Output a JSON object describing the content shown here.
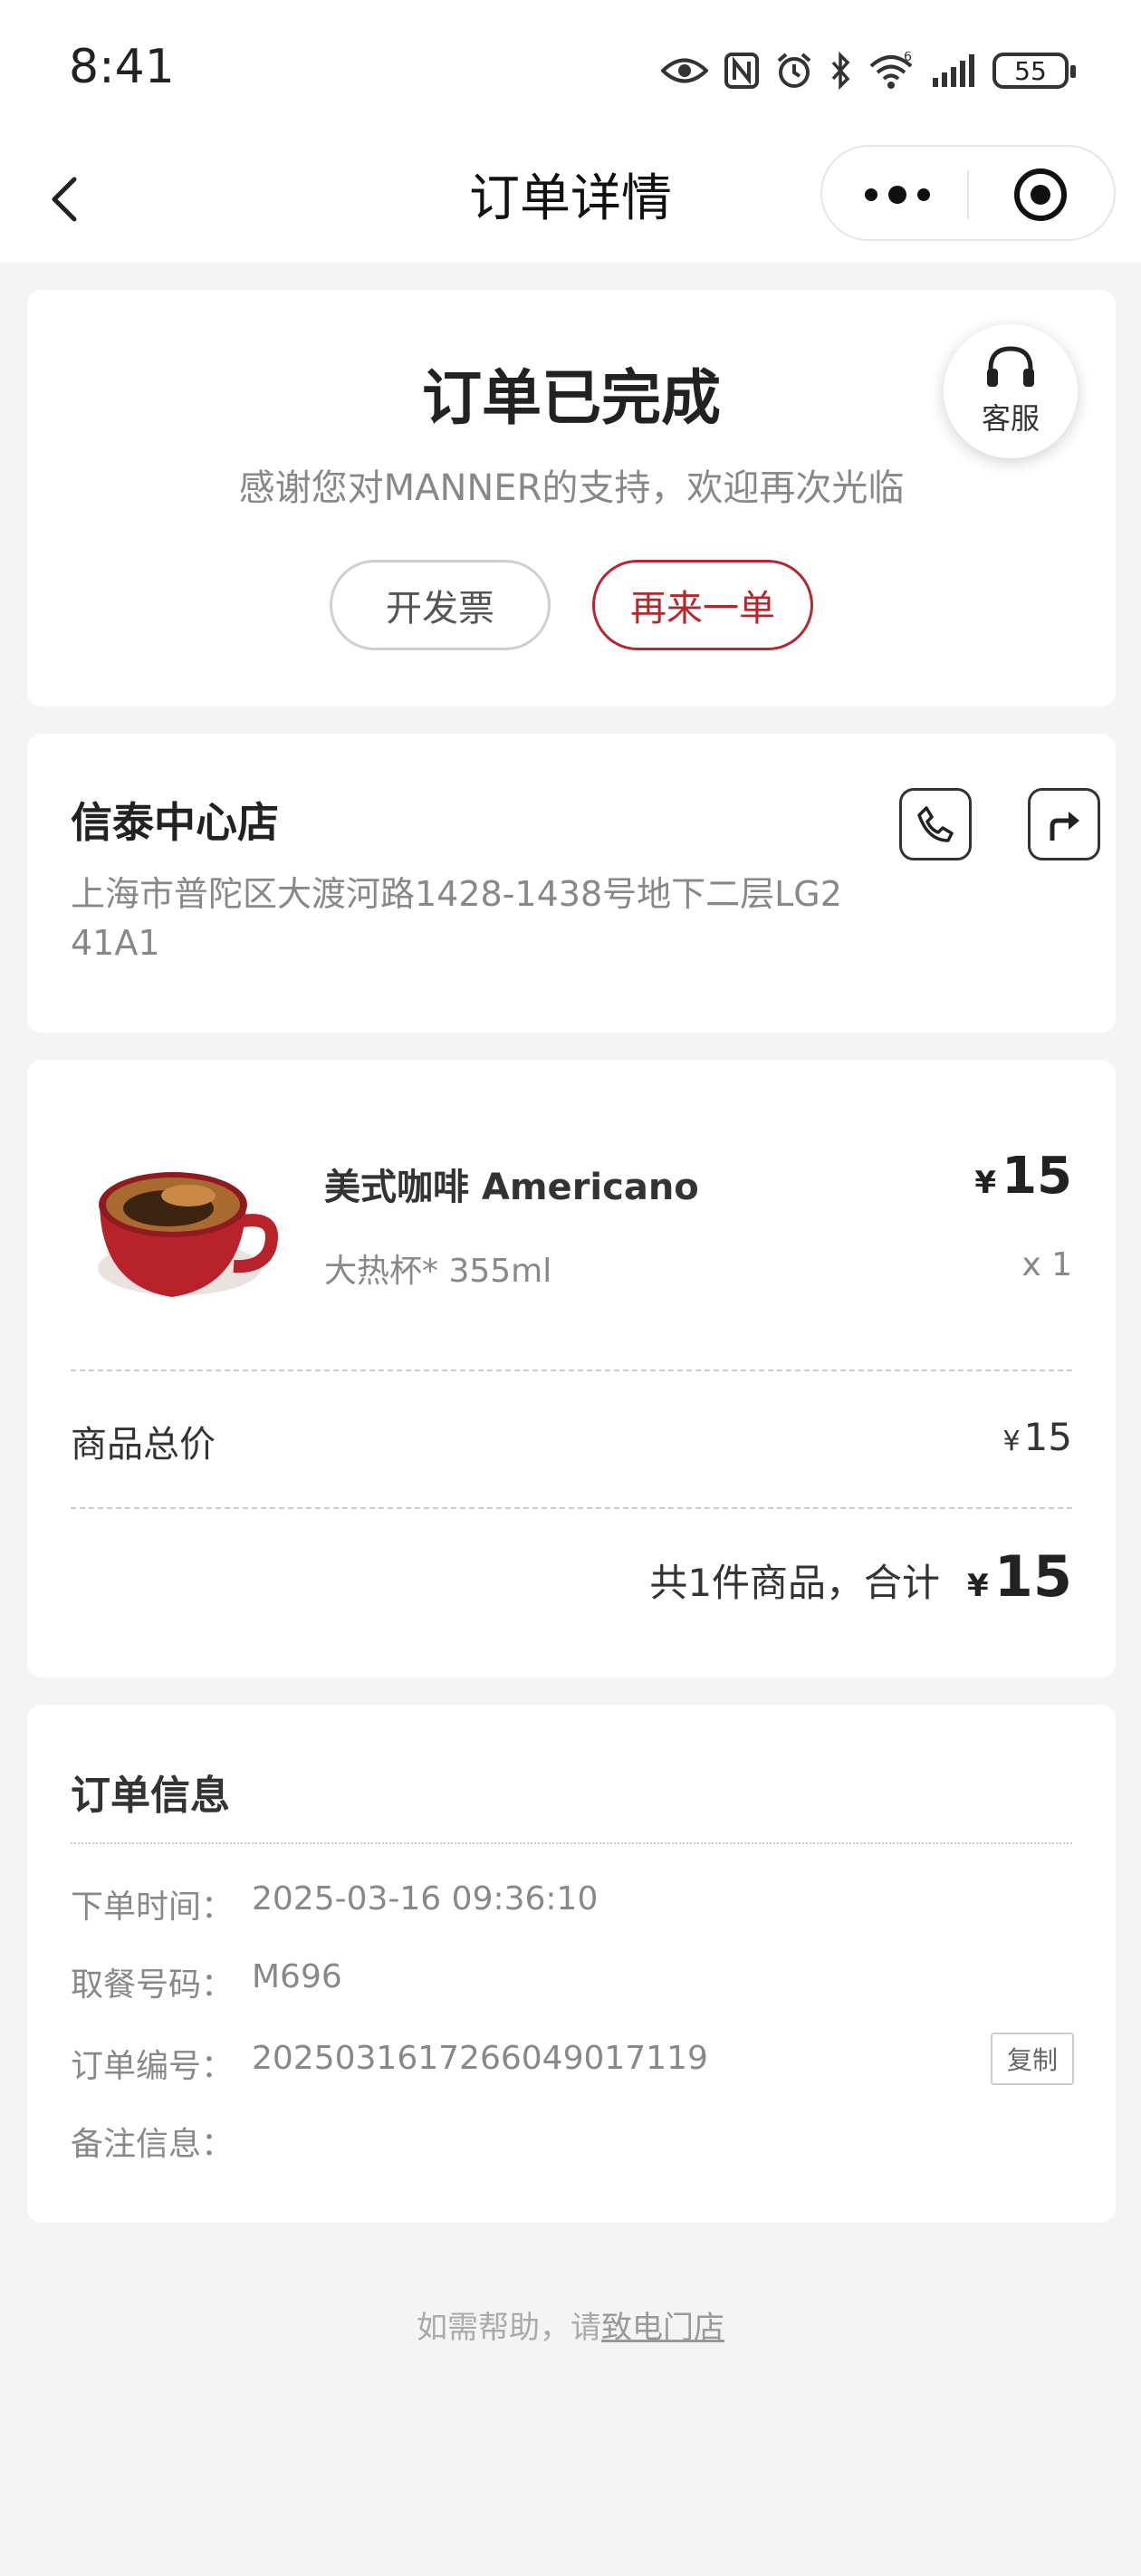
{
  "status_bar": {
    "time": "8:41",
    "battery": "55"
  },
  "nav": {
    "title": "订单详情"
  },
  "order_status": {
    "title": "订单已完成",
    "thanks": "感谢您对MANNER的支持，欢迎再次光临",
    "invoice_button": "开发票",
    "reorder_button": "再来一单",
    "customer_service": "客服"
  },
  "store": {
    "name": "信泰中心店",
    "address": "上海市普陀区大渡河路1428-1438号地下二层LG241A1"
  },
  "goods": {
    "name": "美式咖啡 Americano",
    "spec": "大热杯* 355ml",
    "currency": "¥",
    "price": "15",
    "qty": "x 1",
    "total_label": "商品总价",
    "total_value": "15",
    "summary_text": "共1件商品，合计",
    "sum_value": "15"
  },
  "order_info": {
    "title": "订单信息",
    "rows": [
      {
        "key": "下单时间：",
        "value": "2025-03-16 09:36:10"
      },
      {
        "key": "取餐号码：",
        "value": "M696"
      },
      {
        "key": "订单编号：",
        "value": "20250316172660490171​19"
      },
      {
        "key": "备注信息：",
        "value": ""
      }
    ],
    "copy_button": "复制"
  },
  "footer": {
    "prefix": "如需帮助，请",
    "link": "致电门店"
  },
  "colors": {
    "accent": "#b3282d",
    "background": "#f4f4f4"
  }
}
